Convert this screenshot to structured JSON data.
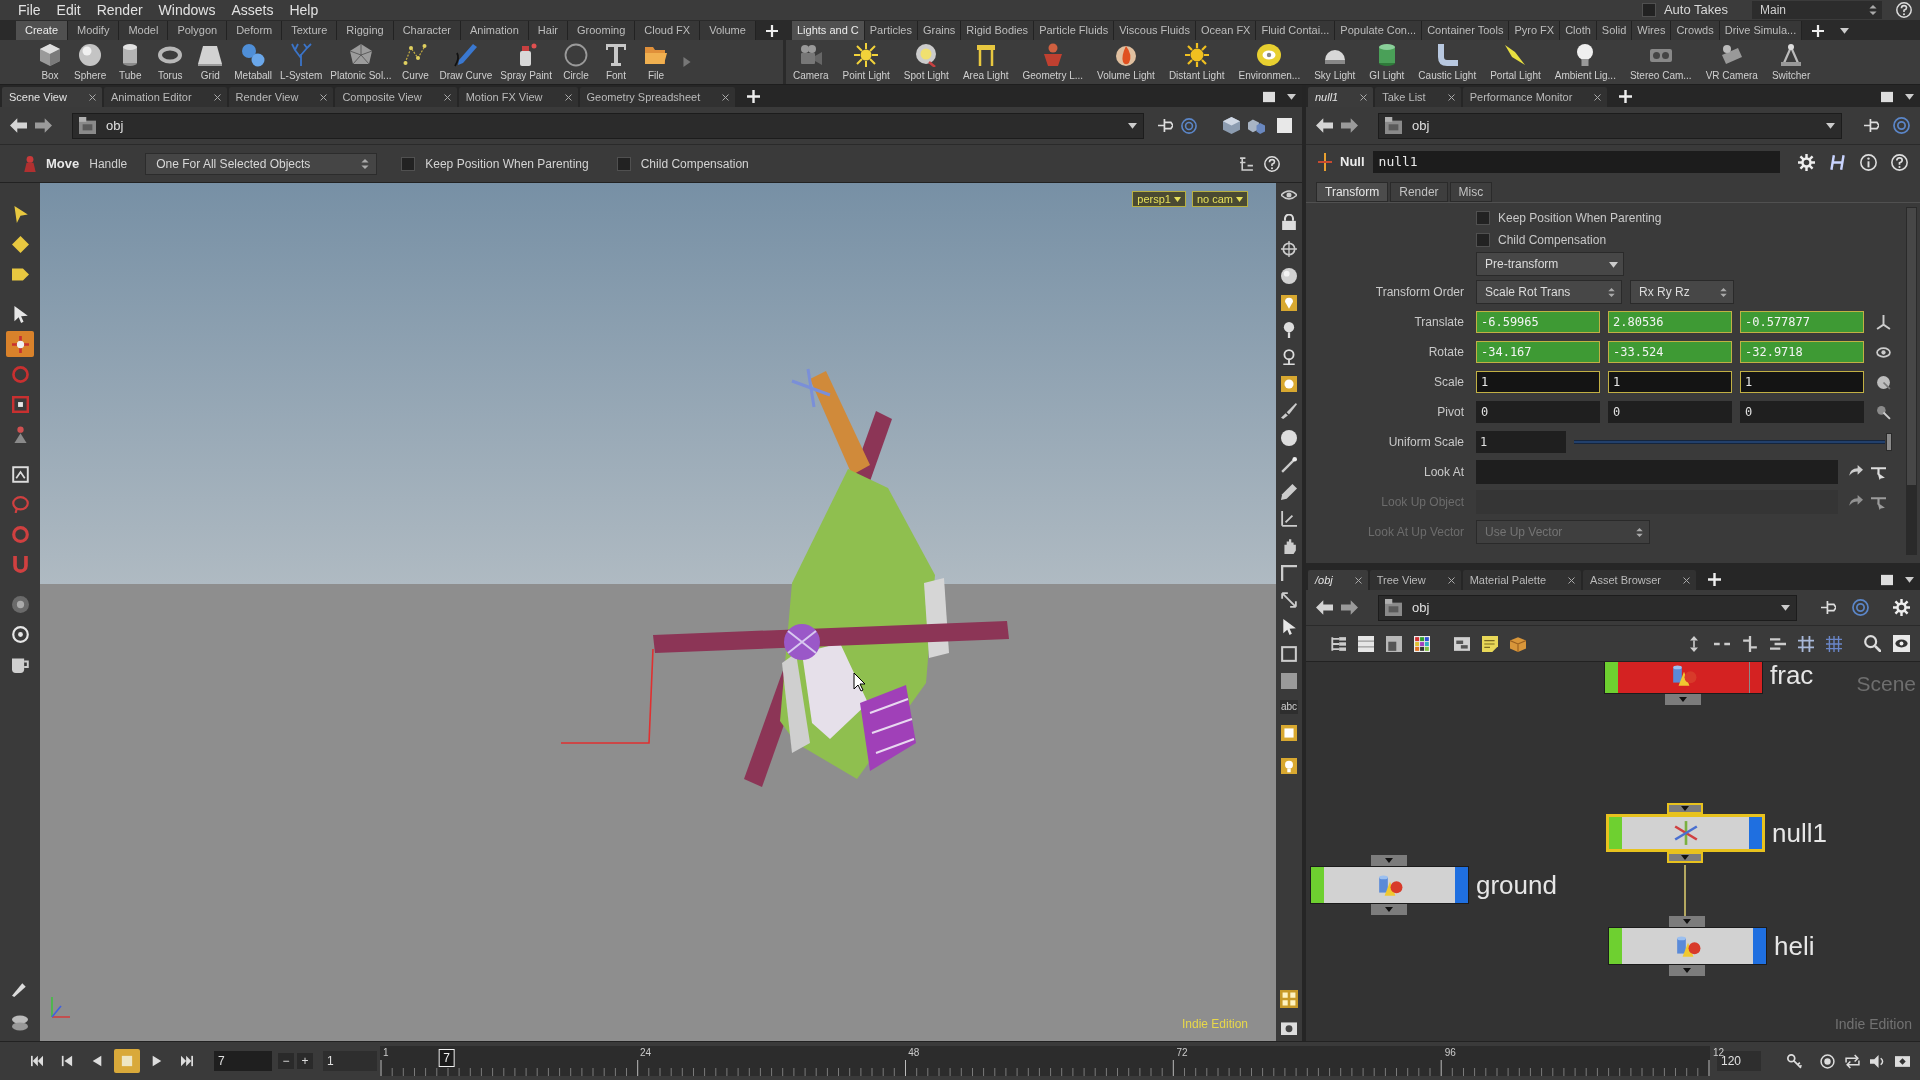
{
  "menu_bar": {
    "menus": [
      "File",
      "Edit",
      "Render",
      "Windows",
      "Assets",
      "Help"
    ],
    "auto_takes": {
      "label": "Auto Takes",
      "checked": false
    },
    "desktop": "Main"
  },
  "shelves": [
    {
      "tabs": [
        {
          "label": "Create",
          "selected": true
        },
        {
          "label": "Modify",
          "selected": false
        },
        {
          "label": "Model",
          "selected": false
        },
        {
          "label": "Polygon",
          "selected": false
        },
        {
          "label": "Deform",
          "selected": false
        },
        {
          "label": "Texture",
          "selected": false
        },
        {
          "label": "Rigging",
          "selected": false
        },
        {
          "label": "Character",
          "selected": false
        },
        {
          "label": "Animation",
          "selected": false
        },
        {
          "label": "Hair",
          "selected": false
        },
        {
          "label": "Grooming",
          "selected": false
        },
        {
          "label": "Cloud FX",
          "selected": false
        },
        {
          "label": "Volume",
          "selected": false
        }
      ],
      "tools": [
        "Box",
        "Sphere",
        "Tube",
        "Torus",
        "Grid",
        "Metaball",
        "L-System",
        "Platonic Sol...",
        "Curve",
        "Draw Curve",
        "Spray Paint",
        "Circle",
        "Font",
        "File"
      ]
    },
    {
      "tabs": [
        {
          "label": "Lights and C",
          "selected": true
        },
        {
          "label": "Particles",
          "selected": false
        },
        {
          "label": "Grains",
          "selected": false
        },
        {
          "label": "Rigid Bodies",
          "selected": false
        },
        {
          "label": "Particle Fluids",
          "selected": false
        },
        {
          "label": "Viscous Fluids",
          "selected": false
        },
        {
          "label": "Ocean FX",
          "selected": false
        },
        {
          "label": "Fluid Contai...",
          "selected": false
        },
        {
          "label": "Populate Con...",
          "selected": false
        },
        {
          "label": "Container Tools",
          "selected": false
        },
        {
          "label": "Pyro FX",
          "selected": false
        },
        {
          "label": "Cloth",
          "selected": false
        },
        {
          "label": "Solid",
          "selected": false
        },
        {
          "label": "Wires",
          "selected": false
        },
        {
          "label": "Crowds",
          "selected": false
        },
        {
          "label": "Drive Simula...",
          "selected": false
        }
      ],
      "tools": [
        "Camera",
        "Point Light",
        "Spot Light",
        "Area Light",
        "Geometry L...",
        "Volume Light",
        "Distant Light",
        "Environmen...",
        "Sky Light",
        "GI Light",
        "Caustic Light",
        "Portal Light",
        "Ambient Lig...",
        "Stereo Cam...",
        "VR Camera",
        "Switcher"
      ]
    }
  ],
  "scene_view": {
    "tabs": [
      {
        "label": "Scene View",
        "selected": true
      },
      {
        "label": "Animation Editor",
        "selected": false
      },
      {
        "label": "Render View",
        "selected": false
      },
      {
        "label": "Composite View",
        "selected": false
      },
      {
        "label": "Motion FX View",
        "selected": false
      },
      {
        "label": "Geometry Spreadsheet",
        "selected": false
      }
    ],
    "path": "obj",
    "operation": {
      "tool": "Move",
      "handle": "Handle",
      "mode": "One For All Selected Objects"
    },
    "options": [
      {
        "label": "Keep Position When Parenting",
        "checked": false
      },
      {
        "label": "Child Compensation",
        "checked": false
      }
    ],
    "left_tools": [
      {
        "selected": false
      },
      {
        "selected": false
      },
      {
        "selected": false
      },
      {
        "selected": false
      },
      {
        "selected": true
      },
      {
        "selected": false
      },
      {
        "selected": false
      },
      {
        "selected": false
      },
      {
        "selected": false
      },
      {
        "selected": false
      },
      {
        "selected": false
      },
      {
        "selected": false
      },
      {
        "selected": false
      },
      {
        "selected": false
      },
      {
        "selected": false
      }
    ],
    "camera_menus": [
      "persp1",
      "no cam"
    ],
    "side_label": "abc",
    "edition": "Indie Edition"
  },
  "parameters": {
    "tabs": [
      {
        "label": "null1",
        "selected": true,
        "italic": true
      },
      {
        "label": "Take List",
        "selected": false,
        "italic": false
      },
      {
        "label": "Performance Monitor",
        "selected": false,
        "italic": false
      }
    ],
    "path": "obj",
    "node_type": "Null",
    "node_name": "null1",
    "param_tabs": [
      {
        "label": "Transform",
        "selected": true
      },
      {
        "label": "Render",
        "selected": false
      },
      {
        "label": "Misc",
        "selected": false
      }
    ],
    "params": [
      {
        "kind": "toggle",
        "label": "Keep Position When Parenting",
        "checked": false,
        "disabled": false
      },
      {
        "kind": "toggle",
        "label": "Child Compensation",
        "checked": false,
        "disabled": false
      },
      {
        "kind": "menu",
        "values": [
          "Pre-transform"
        ],
        "disabled": false
      },
      {
        "kind": "menu",
        "label": "Transform Order",
        "values": [
          "Scale Rot Trans",
          "Rx Ry Rz"
        ],
        "disabled": false
      },
      {
        "kind": "vector",
        "label": "Translate",
        "values": [
          "-6.59965",
          "2.80536",
          "-0.577877"
        ],
        "animated": true,
        "outlined": true,
        "disabled": false
      },
      {
        "kind": "vector",
        "label": "Rotate",
        "values": [
          "-34.167",
          "-33.524",
          "-32.9718"
        ],
        "animated": true,
        "outlined": true,
        "disabled": false
      },
      {
        "kind": "vector",
        "label": "Scale",
        "values": [
          "1",
          "1",
          "1"
        ],
        "animated": false,
        "outlined": true,
        "disabled": false
      },
      {
        "kind": "vector",
        "label": "Pivot",
        "values": [
          "0",
          "0",
          "0"
        ],
        "animated": false,
        "outlined": false,
        "disabled": false
      },
      {
        "kind": "slider",
        "label": "Uniform Scale",
        "value": "1",
        "level": 1,
        "disabled": false
      },
      {
        "kind": "field",
        "label": "Look At",
        "disabled": false
      },
      {
        "kind": "field",
        "label": "Look Up Object",
        "disabled": true
      },
      {
        "kind": "menu",
        "label": "Look At Up Vector",
        "values": [
          "Use Up Vector"
        ],
        "disabled": true
      }
    ]
  },
  "network": {
    "tabs": [
      {
        "label": "/obj",
        "selected": true,
        "italic": true
      },
      {
        "label": "Tree View",
        "selected": false,
        "italic": false
      },
      {
        "label": "Material Palette",
        "selected": false,
        "italic": false
      },
      {
        "label": "Asset Browser",
        "selected": false,
        "italic": false
      }
    ],
    "path": "obj",
    "context": "Scene",
    "edition": "Indie Edition",
    "nodes": [
      {
        "name": "frac",
        "kind": "geometry",
        "color": "#d42222",
        "selected": false,
        "display": false
      },
      {
        "name": "ground",
        "kind": "geometry",
        "color": "#d2d2d2",
        "selected": false,
        "display": true
      },
      {
        "name": "null1",
        "kind": "null",
        "color": "#d2d2d2",
        "selected": true,
        "display": true,
        "children": [
          {
            "name": "heli",
            "kind": "geometry",
            "color": "#d2d2d2",
            "selected": false,
            "display": true
          }
        ]
      }
    ]
  },
  "timeline": {
    "transport": [
      {
        "selected": false
      },
      {
        "selected": false
      },
      {
        "selected": false
      },
      {
        "selected": true
      },
      {
        "selected": false
      },
      {
        "selected": false
      }
    ],
    "frame": "7",
    "step_buttons": [
      "−",
      "+"
    ],
    "start": "1",
    "ticks": [
      "1",
      "24",
      "48",
      "72",
      "96",
      "12"
    ],
    "marker": {
      "label": "7",
      "level": 0.05
    },
    "end": "120"
  }
}
